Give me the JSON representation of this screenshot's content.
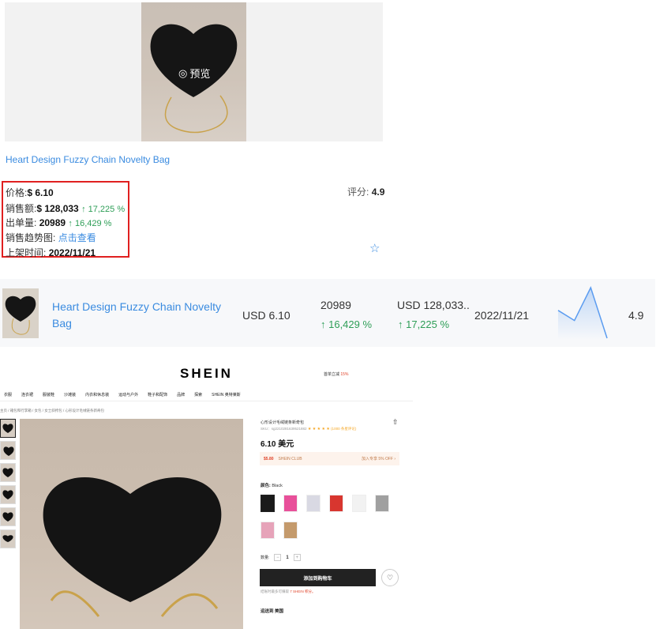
{
  "card": {
    "preview_label": "预览",
    "title": "Heart Design Fuzzy Chain Novelty Bag",
    "price_label": "价格:",
    "price": "$ 6.10",
    "sales_label": "销售额:",
    "sales": "$ 128,033",
    "sales_growth": "↑ 17,225 %",
    "orders_label": "出单量:",
    "orders": "20989",
    "orders_growth": "↑ 16,429 %",
    "trend_label": "销售趋势图:",
    "trend_link": "点击查看",
    "listed_label": "上架时间:",
    "listed_date": "2022/11/21",
    "rating_label": "评分:",
    "rating": "4.9"
  },
  "row": {
    "title": "Heart Design Fuzzy Chain Novelty Bag",
    "price": "USD 6.10",
    "orders": "20989",
    "orders_growth": "↑ 16,429 %",
    "sales": "USD 128,033..",
    "sales_growth": "↑ 17,225 %",
    "date": "2022/11/21",
    "rating": "4.9",
    "trend": [
      0.55,
      0.35,
      1.0,
      0.0
    ]
  },
  "shein": {
    "logo": "SHEIN",
    "promo_prefix": "首单立减",
    "promo_value": "15%",
    "nav": [
      "衣服",
      "连衣裙",
      "服装鞋",
      "沙滩装",
      "内衣和休息装",
      "运动与户外",
      "鞋子和配饰",
      "品牌",
      "探索",
      "SHEIN 奥特莱斯"
    ],
    "breadcrumb": "主页 / 箱包和行李箱 / 女包 / 女士斜挎包 / 心形设计毛绒链条新奇包",
    "title": "心形设计毛绒链条新奇包",
    "sku": "SKU：sg2210281639521882",
    "stars": "★ ★ ★ ★ ★",
    "reviews": "(1000 条星评论)",
    "price": "6.10 美元",
    "club_price": "$5.80",
    "club_label": "SHEIN CLUB",
    "club_offer": "加入专享 5% OFF ›",
    "color_label": "颜色:",
    "color_value": "Black",
    "qty_label": "数量:",
    "qty_value": "1",
    "add_to_cart": "添加到购物车",
    "points_text": "结账时最多可赚取",
    "points_value": "7 SHEIN 积分。",
    "ship_to": "运送到 美国"
  }
}
